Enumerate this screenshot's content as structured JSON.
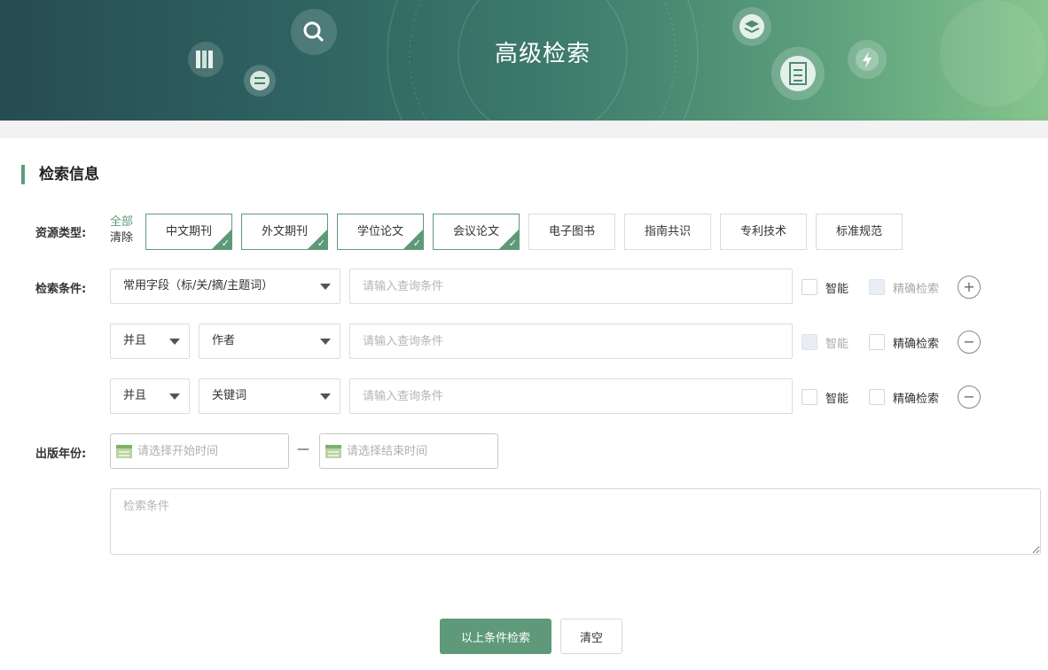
{
  "banner": {
    "title": "高级检索"
  },
  "section": {
    "title": "检索信息"
  },
  "labels": {
    "resource_type": "资源类型:",
    "conditions": "检索条件:",
    "year": "出版年份:"
  },
  "resource_type": {
    "all_label": "全部",
    "clear_label": "清除",
    "types": [
      {
        "label": "中文期刊",
        "selected": true
      },
      {
        "label": "外文期刊",
        "selected": true
      },
      {
        "label": "学位论文",
        "selected": true
      },
      {
        "label": "会议论文",
        "selected": true
      },
      {
        "label": "电子图书",
        "selected": false
      },
      {
        "label": "指南共识",
        "selected": false
      },
      {
        "label": "专利技术",
        "selected": false
      },
      {
        "label": "标准规范",
        "selected": false
      }
    ]
  },
  "conditions": [
    {
      "field": "常用字段（标/关/摘/主题词）",
      "placeholder": "请输入查询条件",
      "smart_label": "智能",
      "smart_disabled": false,
      "exact_label": "精确检索",
      "exact_disabled": true,
      "action": "+"
    },
    {
      "logic": "并且",
      "field": "作者",
      "placeholder": "请输入查询条件",
      "smart_label": "智能",
      "smart_disabled": true,
      "exact_label": "精确检索",
      "exact_disabled": false,
      "action": "−"
    },
    {
      "logic": "并且",
      "field": "关键词",
      "placeholder": "请输入查询条件",
      "smart_label": "智能",
      "smart_disabled": false,
      "exact_label": "精确检索",
      "exact_disabled": false,
      "action": "−"
    }
  ],
  "year": {
    "start_placeholder": "请选择开始时间",
    "end_placeholder": "请选择结束时间",
    "separator": "—"
  },
  "summary": {
    "placeholder": "检索条件"
  },
  "actions": {
    "search_label": "以上条件检索",
    "clear_label": "清空"
  },
  "colors": {
    "accent": "#5e9a79",
    "banner_left": "#274c52",
    "banner_right": "#86c58d"
  },
  "icons": [
    "books-icon",
    "search-icon",
    "swap-icon",
    "layers-icon",
    "document-icon",
    "lightning-icon"
  ]
}
